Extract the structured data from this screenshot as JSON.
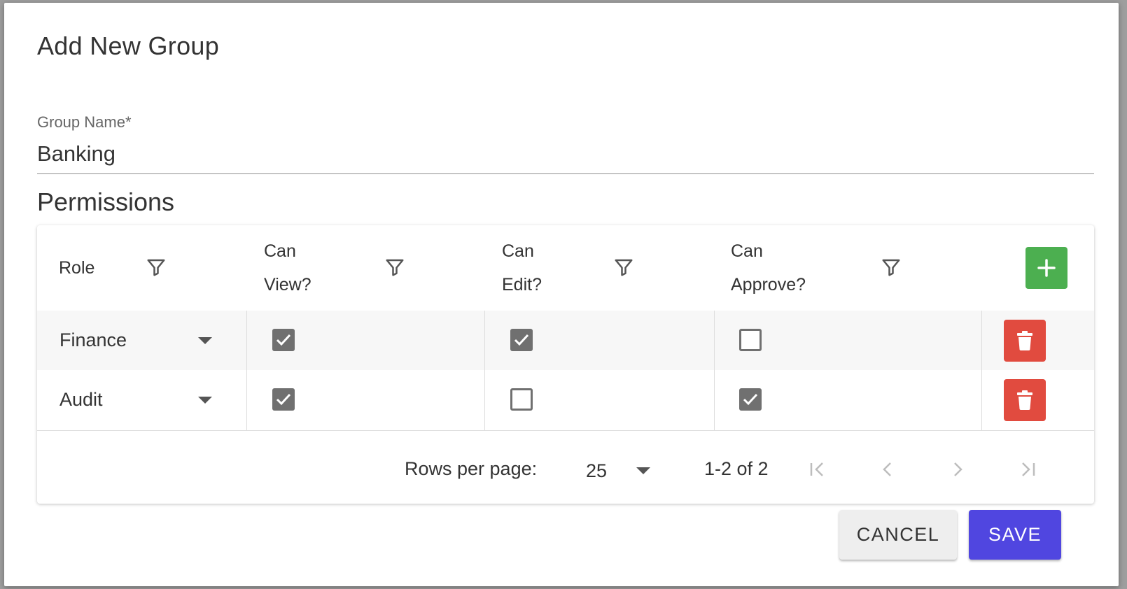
{
  "dialog": {
    "title": "Add New Group",
    "group_name": {
      "label": "Group Name*",
      "value": "Banking"
    },
    "section_title": "Permissions"
  },
  "table": {
    "columns": [
      {
        "line1": "Role",
        "line2": ""
      },
      {
        "line1": "Can",
        "line2": "View?"
      },
      {
        "line1": "Can",
        "line2": "Edit?"
      },
      {
        "line1": "Can",
        "line2": "Approve?"
      }
    ],
    "rows": [
      {
        "role": "Finance",
        "can_view": true,
        "can_edit": true,
        "can_approve": false
      },
      {
        "role": "Audit",
        "can_view": true,
        "can_edit": false,
        "can_approve": true
      }
    ],
    "pagination": {
      "rows_per_page_label": "Rows per page:",
      "rows_per_page": "25",
      "range": "1-2 of 2"
    }
  },
  "actions": {
    "cancel": "CANCEL",
    "save": "SAVE"
  },
  "colors": {
    "add": "#4caf50",
    "delete": "#e14b3f",
    "primary": "#5046e0",
    "checkbox": "#707070"
  },
  "icons": [
    "filter-icon",
    "plus-icon",
    "trash-icon",
    "dropdown-arrow-icon",
    "first-page-icon",
    "prev-page-icon",
    "next-page-icon",
    "last-page-icon"
  ]
}
